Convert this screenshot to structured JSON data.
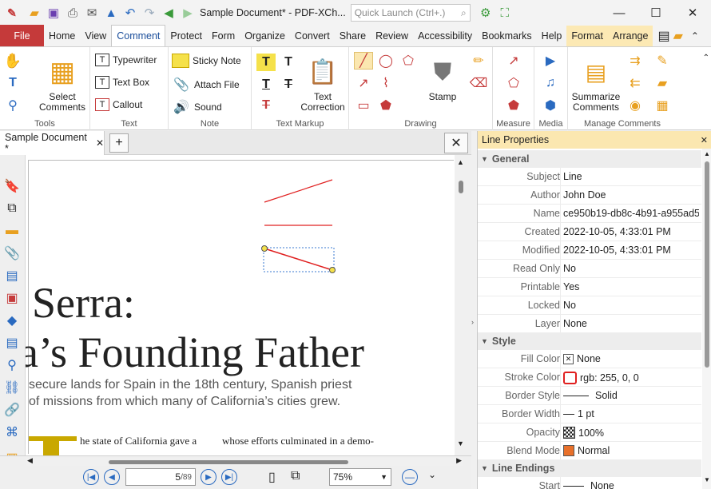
{
  "title_bar": {
    "title": "Sample Document* - PDF-XCh...",
    "quick_launch_placeholder": "Quick Launch (Ctrl+.)"
  },
  "menu": {
    "file": "File",
    "tabs": [
      "Home",
      "View",
      "Comment",
      "Protect",
      "Form",
      "Organize",
      "Convert",
      "Share",
      "Review",
      "Accessibility",
      "Bookmarks",
      "Help",
      "Format",
      "Arrange"
    ],
    "active": "Comment"
  },
  "ribbon": {
    "tools": {
      "select_comments": "Select\nComments",
      "label": "Tools"
    },
    "text": {
      "typewriter": "Typewriter",
      "text_box": "Text Box",
      "callout": "Callout",
      "label": "Text"
    },
    "note": {
      "sticky_note": "Sticky Note",
      "attach_file": "Attach File",
      "sound": "Sound",
      "label": "Note"
    },
    "text_markup": {
      "text_correction": "Text\nCorrection",
      "label": "Text Markup"
    },
    "drawing": {
      "stamp": "Stamp",
      "label": "Drawing"
    },
    "measure": {
      "label": "Measure"
    },
    "media": {
      "label": "Media"
    },
    "manage": {
      "summarize": "Summarize\nComments",
      "label": "Manage Comments"
    }
  },
  "document": {
    "tab_title": "Sample Document *",
    "heading_line1": "Serra:",
    "heading_line2": "a’s Founding Father",
    "sub_line1": "secure lands for Spain in the 18th century, Spanish priest",
    "sub_line2": "of missions from which many of California’s cities grew.",
    "body_left": "he state of California gave a",
    "body_right": "whose efforts culminated in a demo-"
  },
  "status": {
    "page_current": "5",
    "page_total": "89",
    "zoom": "75%"
  },
  "panel": {
    "title": "Line Properties",
    "sections": {
      "general": "General",
      "style": "Style",
      "line_endings": "Line Endings"
    },
    "general_rows": [
      {
        "label": "Subject",
        "value": "Line"
      },
      {
        "label": "Author",
        "value": "John Doe"
      },
      {
        "label": "Name",
        "value": "ce950b19-db8c-4b91-a955ad5.."
      },
      {
        "label": "Created",
        "value": "2022-10-05, 4:33:01 PM"
      },
      {
        "label": "Modified",
        "value": "2022-10-05, 4:33:01 PM"
      },
      {
        "label": "Read Only",
        "value": "No"
      },
      {
        "label": "Printable",
        "value": "Yes"
      },
      {
        "label": "Locked",
        "value": "No"
      },
      {
        "label": "Layer",
        "value": "None"
      }
    ],
    "style_rows": [
      {
        "label": "Fill Color",
        "value": "None"
      },
      {
        "label": "Stroke Color",
        "value": "rgb: 255, 0, 0"
      },
      {
        "label": "Border Style",
        "value": "Solid"
      },
      {
        "label": "Border Width",
        "value": "1 pt"
      },
      {
        "label": "Opacity",
        "value": "100%"
      },
      {
        "label": "Blend Mode",
        "value": "Normal"
      }
    ],
    "ending_rows": [
      {
        "label": "Start",
        "value": "None"
      }
    ]
  },
  "colors": {
    "file_tab": "#c53a3a",
    "panel_header": "#fbe7b0",
    "line_red": "#e02020",
    "accent_blue": "#1a4d9a"
  }
}
